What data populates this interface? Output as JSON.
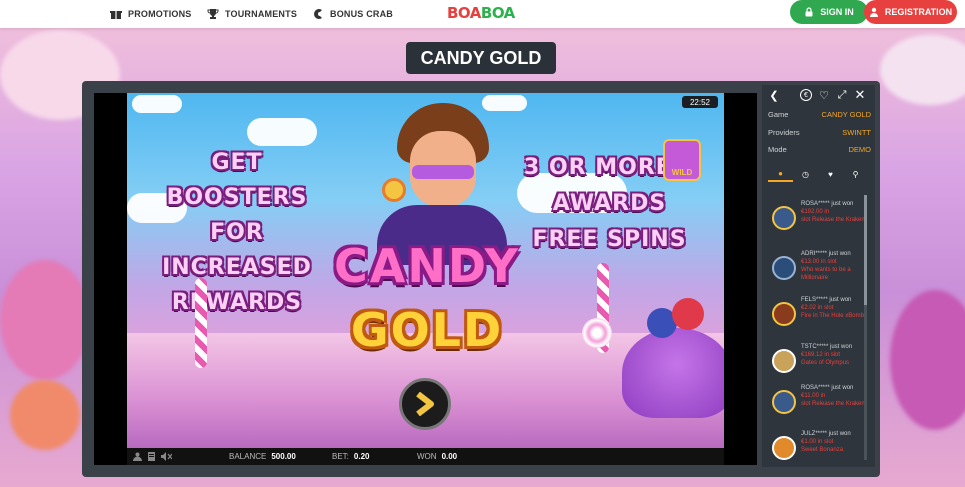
{
  "nav": {
    "promotions": "PROMOTIONS",
    "tournaments": "TOURNAMENTS",
    "bonus_crab": "BONUS CRAB",
    "logo_part1": "BOA",
    "logo_part2": "BOA",
    "sign_in": "SIGN IN",
    "registration": "REGISTRATION"
  },
  "game_title": "CANDY GOLD",
  "game": {
    "clock": "22:52",
    "left_promo": [
      "GET BOOSTERS",
      "FOR INCREASED",
      "REWARDS"
    ],
    "right_promo": [
      "3 OR MORE",
      "AWARDS",
      "FREE SPINS"
    ],
    "logo_line1": "CANDY",
    "logo_line2": "GOLD",
    "wild_label": "WILD",
    "balance_label": "BALANCE",
    "balance_value": "500.00",
    "bet_label": "BET:",
    "bet_value": "0.20",
    "won_label": "WON",
    "won_value": "0.00"
  },
  "panel": {
    "info": [
      {
        "label": "Game",
        "value": "CANDY GOLD"
      },
      {
        "label": "Providers",
        "value": "SWINTT"
      },
      {
        "label": "Mode",
        "value": "DEMO"
      }
    ],
    "feed": [
      {
        "user": "ROSA*****",
        "pre": "just won",
        "amount": "€192.00 in",
        "post": "slot Release the Kraken",
        "thumb_color": "#3a5a8c"
      },
      {
        "user": "ADRI*****",
        "pre": "just won",
        "amount": "€13.00 in slot",
        "post": "Who wants to be a Millionaire",
        "thumb_color": "#2a4d7a"
      },
      {
        "user": "FELS*****",
        "pre": "just won",
        "amount": "€2.02 in slot",
        "post": "Fire in The Hole xBomb",
        "thumb_color": "#8a3b1e"
      },
      {
        "user": "TSTC*****",
        "pre": "just won",
        "amount": "€169.12 in slot",
        "post": "Gates of Olympus",
        "thumb_color": "#c9a35a"
      },
      {
        "user": "ROSA*****",
        "pre": "just won",
        "amount": "€11.00 in",
        "post": "slot Release the Kraken",
        "thumb_color": "#3a5a8c"
      },
      {
        "user": "JULZ*****",
        "pre": "just won",
        "amount": "€1.00 in slot",
        "post": "Sweet Bonanza",
        "thumb_color": "#e08a2c"
      }
    ]
  }
}
